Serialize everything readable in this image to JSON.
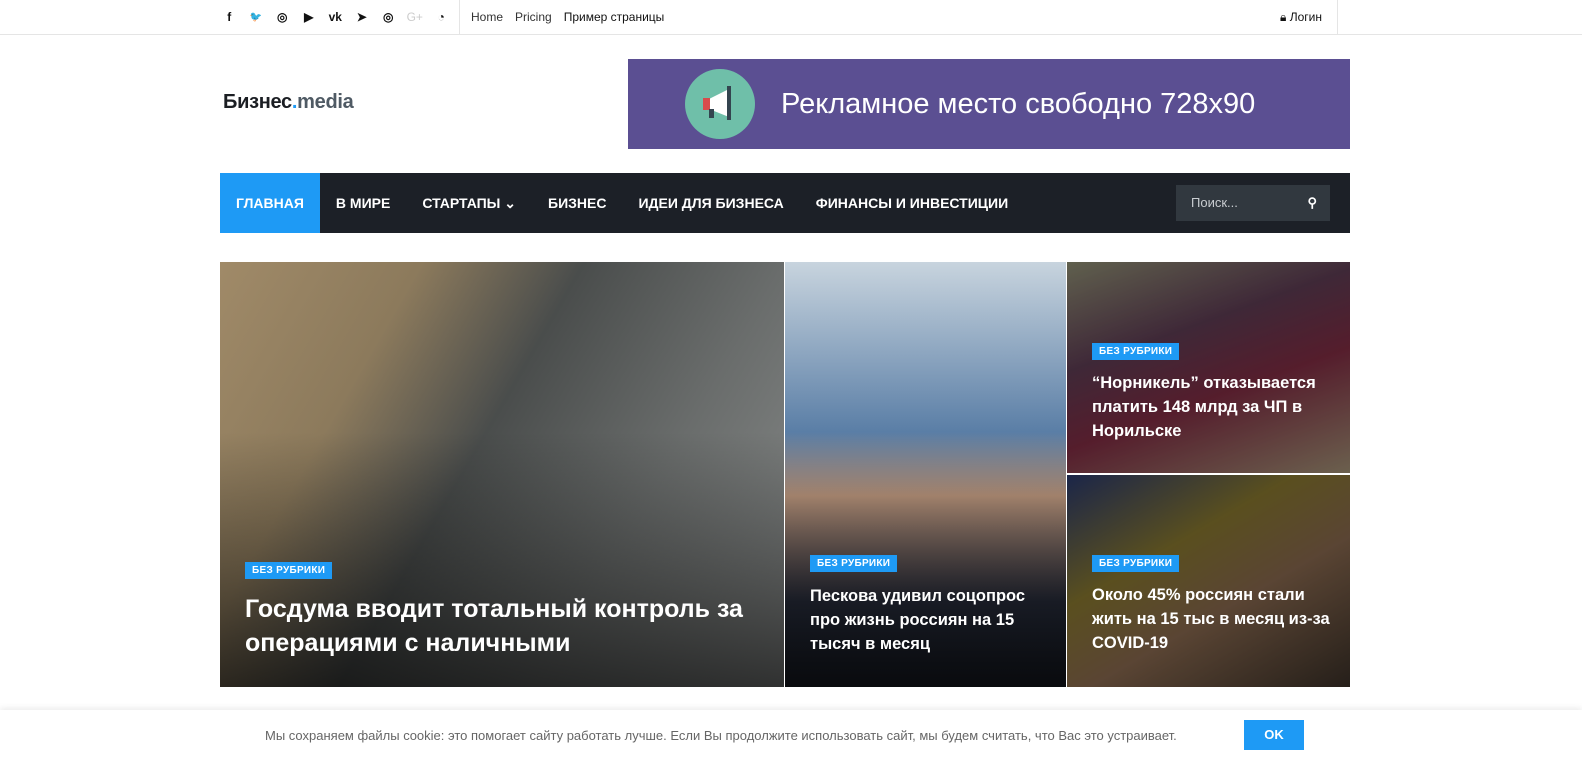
{
  "topbar": {
    "social": [
      {
        "icon": "facebook-icon",
        "glyph": "f"
      },
      {
        "icon": "twitter-icon",
        "glyph": "🐦"
      },
      {
        "icon": "instagram-icon",
        "glyph": "◎"
      },
      {
        "icon": "youtube-icon",
        "glyph": "▶"
      },
      {
        "icon": "vk-icon",
        "glyph": "vk"
      },
      {
        "icon": "telegram-icon",
        "glyph": "➤"
      },
      {
        "icon": "instagram-icon",
        "glyph": "◎"
      },
      {
        "icon": "google-plus-icon",
        "glyph": "G+"
      },
      {
        "icon": "rss-icon",
        "glyph": "◔"
      }
    ],
    "links": [
      "Home",
      "Pricing",
      "Пример страницы"
    ],
    "login": "Логин"
  },
  "logo": {
    "name": "Бизнес",
    "dot": ".",
    "suffix": "media"
  },
  "ad": {
    "text": "Рекламное место свободно  728x90"
  },
  "nav": {
    "items": [
      "ГЛАВНАЯ",
      "В МИРЕ",
      "СТАРТАПЫ ⌄",
      "БИЗНЕС",
      "ИДЕИ ДЛЯ БИЗНЕСА",
      "ФИНАНСЫ И ИНВЕСТИЦИИ"
    ],
    "search_placeholder": "Поиск..."
  },
  "hero": [
    {
      "category": "БЕЗ РУБРИКИ",
      "title": "Госдума вводит тотальный контроль за операциями с наличными"
    },
    {
      "category": "БЕЗ РУБРИКИ",
      "title": "Пескова удивил соцопрос про жизнь россиян на 15 тысяч в месяц"
    },
    {
      "category": "БЕЗ РУБРИКИ",
      "title": "“Норникель” отказывается платить 148 млрд за ЧП в Норильске"
    },
    {
      "category": "БЕЗ РУБРИКИ",
      "title": "Около 45% россиян стали жить на 15 тыс в месяц из-за COVID-19"
    }
  ],
  "cookie": {
    "text": "Мы сохраняем файлы cookie: это помогает сайту работать лучше. Если Вы продолжите использовать сайт, мы будем считать, что Вас это устраивает.",
    "ok": "OK"
  }
}
